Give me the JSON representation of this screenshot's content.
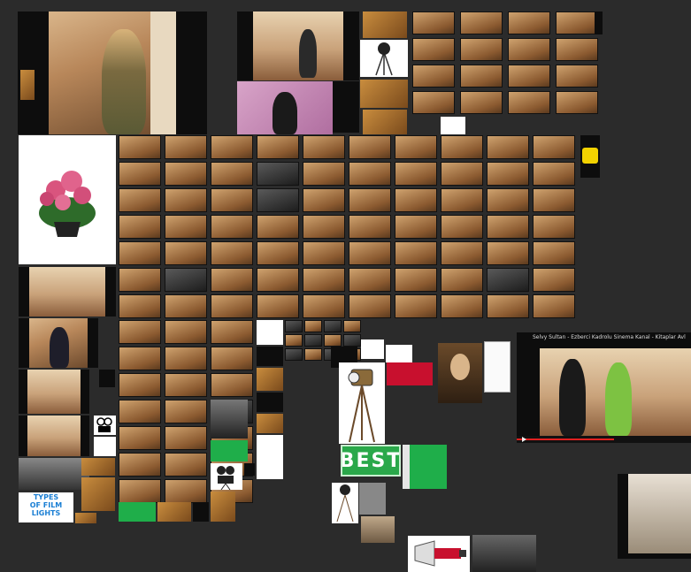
{
  "collage": {
    "background": "#2b2b2b"
  },
  "tiles": {
    "types_of_film_lights": {
      "line1": "TYPES",
      "line2": "OF FILM",
      "line3": "LIGHTS"
    },
    "best_logo": "BEST",
    "video_player": {
      "title": "Selvy Sultan - Ezberci Kadrolu Sinema Kanal - Kitaplar Avl"
    }
  },
  "icons": [
    "flower-pot-icon",
    "film-light-icon",
    "movie-camera-icon",
    "megaphone-icon",
    "play-icon"
  ]
}
